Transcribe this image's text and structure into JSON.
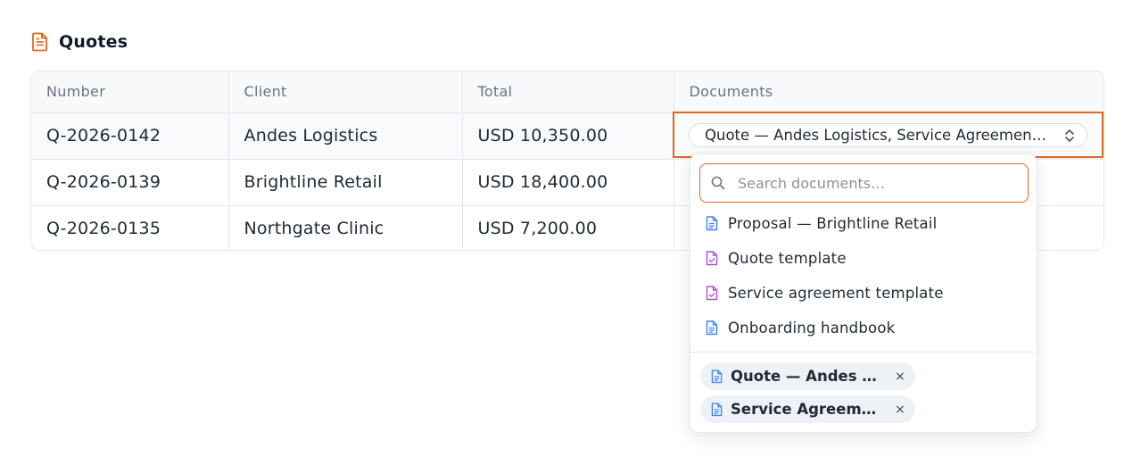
{
  "page": {
    "title": "Quotes"
  },
  "table": {
    "columns": [
      "Number",
      "Client",
      "Total",
      "Documents"
    ],
    "rows": [
      {
        "number": "Q-2026-0142",
        "client": "Andes Logistics",
        "total": "USD 10,350.00"
      },
      {
        "number": "Q-2026-0139",
        "client": "Brightline Retail",
        "total": "USD 18,400.00"
      },
      {
        "number": "Q-2026-0135",
        "client": "Northgate Clinic",
        "total": "USD 7,200.00"
      }
    ]
  },
  "documents_select": {
    "value": "Quote — Andes Logistics, Service Agreemen…",
    "search_placeholder": "Search documents…",
    "options": [
      {
        "label": "Proposal — Brightline Retail",
        "icon": "document-icon"
      },
      {
        "label": "Quote template",
        "icon": "template-icon"
      },
      {
        "label": "Service agreement template",
        "icon": "template-icon"
      },
      {
        "label": "Onboarding handbook",
        "icon": "document-icon"
      }
    ],
    "selected": [
      {
        "label": "Quote — Andes Lo…",
        "remove": "×"
      },
      {
        "label": "Service Agreemen…",
        "remove": "×"
      }
    ]
  },
  "colors": {
    "accent": "#e0671d",
    "document_icon": "#3b82f6",
    "template_icon": "#b04fd6"
  }
}
